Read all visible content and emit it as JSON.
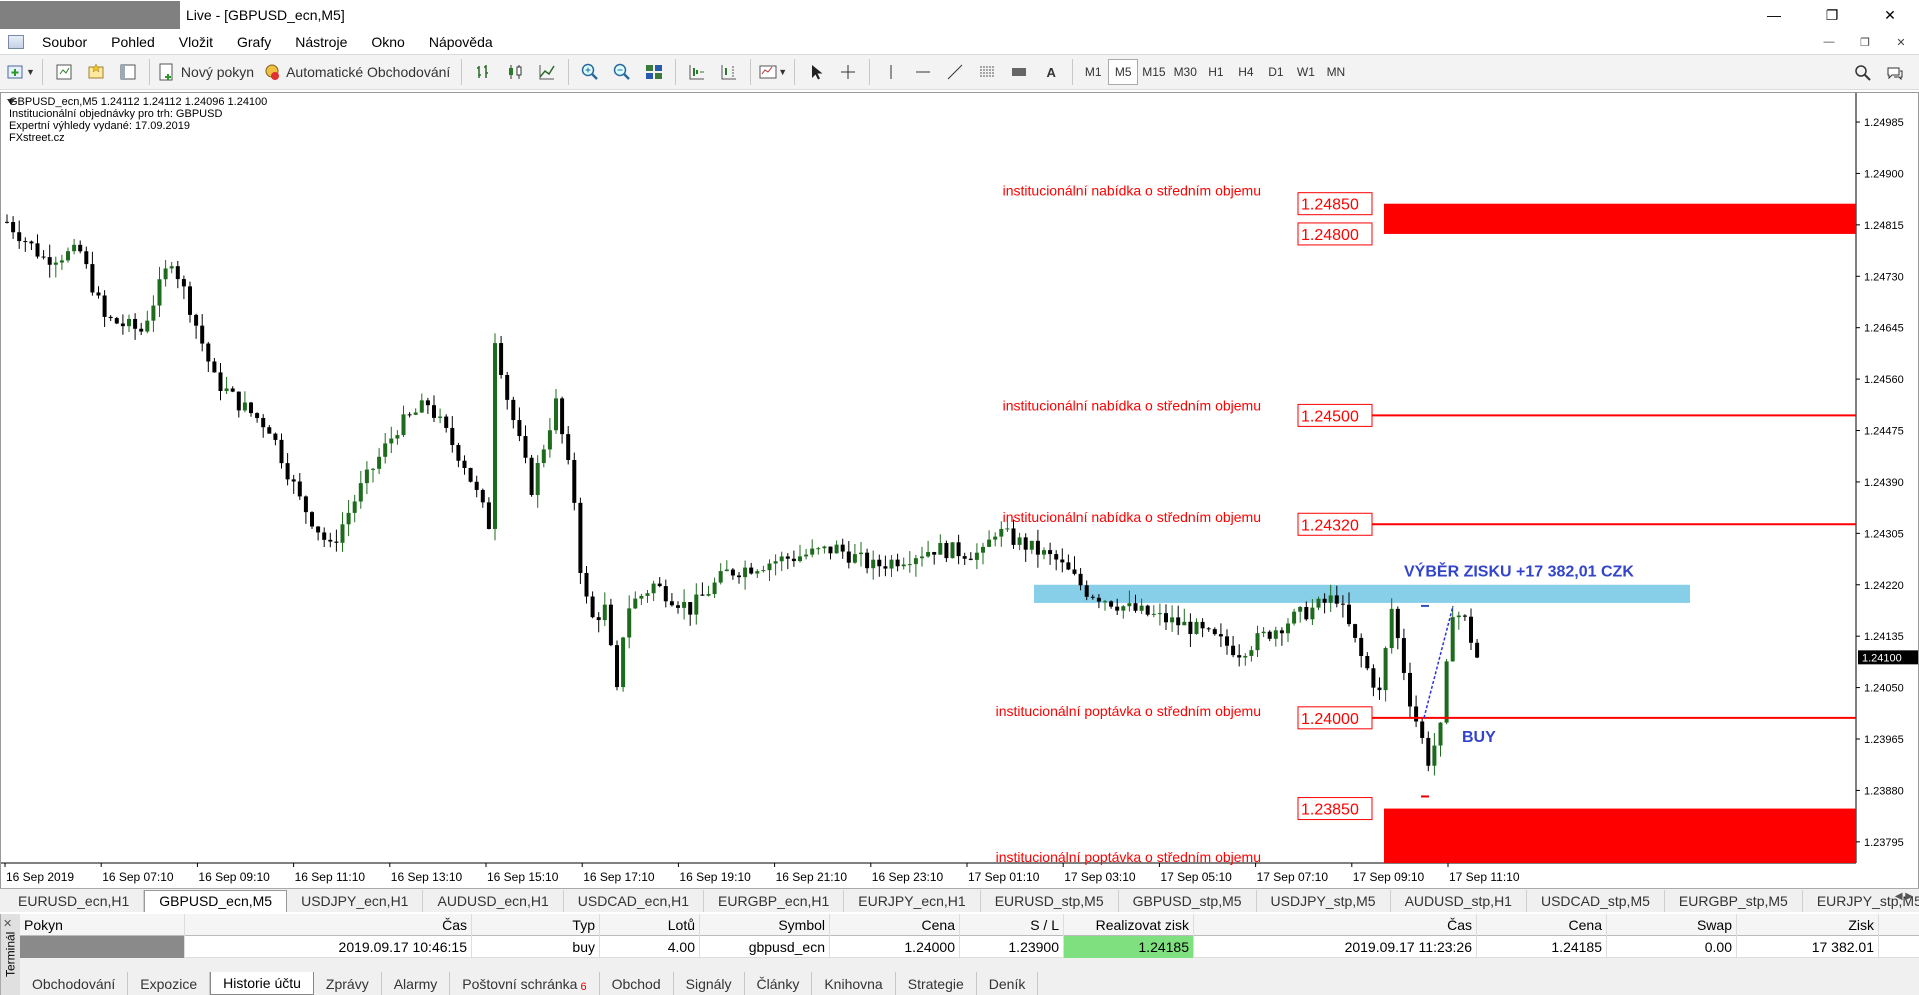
{
  "window": {
    "title": "Live - [GBPUSD_ecn,M5]"
  },
  "menu": {
    "items": [
      "Soubor",
      "Pohled",
      "Vložit",
      "Grafy",
      "Nástroje",
      "Okno",
      "Nápověda"
    ]
  },
  "toolbar": {
    "new_order": "Nový pokyn",
    "autotrading": "Automatické Obchodování",
    "text_tool": "A",
    "timeframes": [
      "M1",
      "M5",
      "M15",
      "M30",
      "H1",
      "H4",
      "D1",
      "W1",
      "MN"
    ],
    "active_timeframe": "M5"
  },
  "info": {
    "line1": "GBPUSD_ecn,M5  1.24112 1.24112 1.24096 1.24100",
    "line2": "Institucionální objednávky pro trh: GBPUSD",
    "line3": "Expertní výhledy vydané: 17.09.2019",
    "line4": "FXstreet.cz"
  },
  "annotations": {
    "offer1": "institucionální nabídka o středním objemu",
    "offer2": "institucionální nabídka o středním objemu",
    "offer3": "institucionální nabídka o středním objemu",
    "demand1": "institucionální poptávka o středním objemu",
    "demand2": "institucionální poptávka o středním objemu",
    "profit": "VÝBĚR ZISKU +17 382,01 CZK",
    "buy": "BUY"
  },
  "chart_data": {
    "type": "candlestick",
    "symbol": "GBPUSD_ecn",
    "timeframe": "M5",
    "price_axis": {
      "ticks": [
        "1.24985",
        "1.24900",
        "1.24815",
        "1.24730",
        "1.24645",
        "1.24560",
        "1.24475",
        "1.24390",
        "1.24305",
        "1.24220",
        "1.24135",
        "1.24050",
        "1.23965",
        "1.23880",
        "1.23795"
      ],
      "current": "1.24100",
      "min": 1.2376,
      "max": 1.25033
    },
    "time_axis": {
      "ticks": [
        "16 Sep 2019",
        "16 Sep 07:10",
        "16 Sep 09:10",
        "16 Sep 11:10",
        "16 Sep 13:10",
        "16 Sep 15:10",
        "16 Sep 17:10",
        "16 Sep 19:10",
        "16 Sep 21:10",
        "16 Sep 23:10",
        "17 Sep 01:10",
        "17 Sep 03:10",
        "17 Sep 05:10",
        "17 Sep 07:10",
        "17 Sep 09:10",
        "17 Sep 11:10"
      ]
    },
    "levels": [
      {
        "label": "1.24850",
        "price": 1.2485,
        "zone_to": 1.248,
        "type": "offer-zone"
      },
      {
        "label": "1.24800",
        "price": 1.248,
        "type": "zone-bottom"
      },
      {
        "label": "1.24500",
        "price": 1.245,
        "type": "offer-line"
      },
      {
        "label": "1.24320",
        "price": 1.2432,
        "type": "offer-line"
      },
      {
        "label": "1.24000",
        "price": 1.24,
        "type": "demand-line"
      },
      {
        "label": "1.23850",
        "price": 1.2385,
        "zone_to": 1.2376,
        "type": "demand-zone"
      }
    ],
    "profit_zone": {
      "from": 1.2419,
      "to": 1.2422
    },
    "trade": {
      "entry": 1.24,
      "exit": 1.24185
    },
    "colors": {
      "bull": "#1e6b1e",
      "bear": "#000000",
      "levels": "#ff0000",
      "profit_zone": "#87cee8",
      "annotation_blue": "#3344cc"
    },
    "anchors": [
      [
        0,
        1.2482
      ],
      [
        30,
        1.2476
      ],
      [
        60,
        1.2477
      ],
      [
        80,
        1.2466
      ],
      [
        110,
        1.2464
      ],
      [
        135,
        1.2476
      ],
      [
        150,
        1.2468
      ],
      [
        170,
        1.2456
      ],
      [
        190,
        1.2452
      ],
      [
        215,
        1.2448
      ],
      [
        240,
        1.2436
      ],
      [
        265,
        1.2428
      ],
      [
        290,
        1.2438
      ],
      [
        320,
        1.2448
      ],
      [
        345,
        1.2452
      ],
      [
        375,
        1.2442
      ],
      [
        395,
        1.2432
      ],
      [
        400,
        1.2463
      ],
      [
        410,
        1.2453
      ],
      [
        430,
        1.2438
      ],
      [
        450,
        1.2452
      ],
      [
        465,
        1.2436
      ],
      [
        470,
        1.2425
      ],
      [
        478,
        1.2416
      ],
      [
        490,
        1.2418
      ],
      [
        500,
        1.2404
      ],
      [
        507,
        1.2418
      ],
      [
        530,
        1.2422
      ],
      [
        560,
        1.2418
      ],
      [
        590,
        1.2424
      ],
      [
        630,
        1.2426
      ],
      [
        680,
        1.2428
      ],
      [
        710,
        1.2425
      ],
      [
        760,
        1.2428
      ],
      [
        800,
        1.2427
      ],
      [
        810,
        1.2431
      ],
      [
        840,
        1.2428
      ],
      [
        860,
        1.2426
      ],
      [
        885,
        1.2421
      ],
      [
        920,
        1.2418
      ],
      [
        970,
        1.2415
      ],
      [
        1010,
        1.2411
      ],
      [
        1050,
        1.2416
      ],
      [
        1090,
        1.242
      ],
      [
        1110,
        1.241
      ],
      [
        1125,
        1.2404
      ],
      [
        1135,
        1.2418
      ],
      [
        1150,
        1.2403
      ],
      [
        1165,
        1.2393
      ],
      [
        1175,
        1.2398
      ],
      [
        1185,
        1.2418
      ],
      [
        1195,
        1.2416
      ],
      [
        1205,
        1.241
      ]
    ]
  },
  "symbol_tabs": [
    "EURUSD_ecn,H1",
    "GBPUSD_ecn,M5",
    "USDJPY_ecn,H1",
    "AUDUSD_ecn,H1",
    "USDCAD_ecn,H1",
    "EURGBP_ecn,H1",
    "EURJPY_ecn,H1",
    "EURUSD_stp,M5",
    "GBPUSD_stp,M5",
    "USDJPY_stp,M5",
    "AUDUSD_stp,H1",
    "USDCAD_stp,M5",
    "EURGBP_stp,M5",
    "EURJPY_stp,M5"
  ],
  "active_symbol_tab": "GBPUSD_ecn,M5",
  "terminal": {
    "label": "Terminál",
    "headers": [
      "Pokyn",
      "Čas",
      "Typ",
      "Lotů",
      "Symbol",
      "Cena",
      "S / L",
      "Realizovat zisk",
      "Čas",
      "Cena",
      "Swap",
      "Zisk"
    ],
    "row": [
      "",
      "2019.09.17 10:46:15",
      "buy",
      "4.00",
      "gbpusd_ecn",
      "1.24000",
      "1.23900",
      "1.24185",
      "2019.09.17 11:23:26",
      "1.24185",
      "0.00",
      "17 382.01"
    ],
    "tabs": [
      "Obchodování",
      "Expozice",
      "Historie účtu",
      "Zprávy",
      "Alarmy",
      "Poštovní schránka",
      "Obchod",
      "Signály",
      "Články",
      "Knihovna",
      "Strategie",
      "Deník"
    ],
    "mail_badge": "6",
    "active_tab": "Historie účtu"
  }
}
